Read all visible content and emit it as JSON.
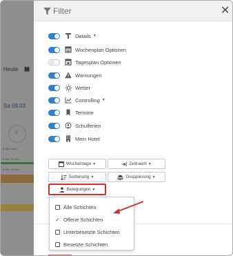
{
  "background": {
    "today_label": "Heute",
    "date_label": "Sa 09.03.",
    "circle_value": "0",
    "small_lines": [
      "0 Std. 0 Min.",
      "0 Std. 15 Min.",
      "0 Std. 15 Min."
    ]
  },
  "panel": {
    "title": "Filter",
    "close_symbol": "✕"
  },
  "options": [
    {
      "label": "Details",
      "icon": "info-icon",
      "on": true,
      "has_caret": true
    },
    {
      "label": "Wochenplan Optionen",
      "icon": "calendar-week-icon",
      "on": true,
      "has_caret": false
    },
    {
      "label": "Tagesplan Optionen",
      "icon": "calendar-day-icon",
      "on": false,
      "has_caret": false
    },
    {
      "label": "Warnungen",
      "icon": "warning-icon",
      "on": true,
      "has_caret": false
    },
    {
      "label": "Wetter",
      "icon": "sun-icon",
      "on": true,
      "has_caret": false
    },
    {
      "label": "Controlling",
      "icon": "chart-line-icon",
      "on": true,
      "has_caret": true
    },
    {
      "label": "Termine",
      "icon": "bookmark-icon",
      "on": true,
      "has_caret": false
    },
    {
      "label": "Schulferien",
      "icon": "school-icon",
      "on": true,
      "has_caret": false
    },
    {
      "label": "Mein Hotel",
      "icon": "building-icon",
      "on": true,
      "has_caret": false
    }
  ],
  "buttons": {
    "wochentage": "Wochentage",
    "zeitraum": "Zeitraum",
    "sortierung": "Sortierung",
    "gruppierung": "Gruppierung",
    "belegungen": "Belegungen"
  },
  "menu": [
    {
      "label": "Alle Schichten",
      "checked": false,
      "type": "checkbox"
    },
    {
      "label": "Offene Schichten",
      "checked": true,
      "type": "tick"
    },
    {
      "label": "Unterbesetzte Schichten",
      "checked": false,
      "type": "checkbox"
    },
    {
      "label": "Besetzte Schichten",
      "checked": false,
      "type": "checkbox"
    }
  ],
  "colors": {
    "toggle_on": "#2f80d1",
    "highlight": "#d62d2d",
    "annotation_arrow": "#d62d2d"
  }
}
